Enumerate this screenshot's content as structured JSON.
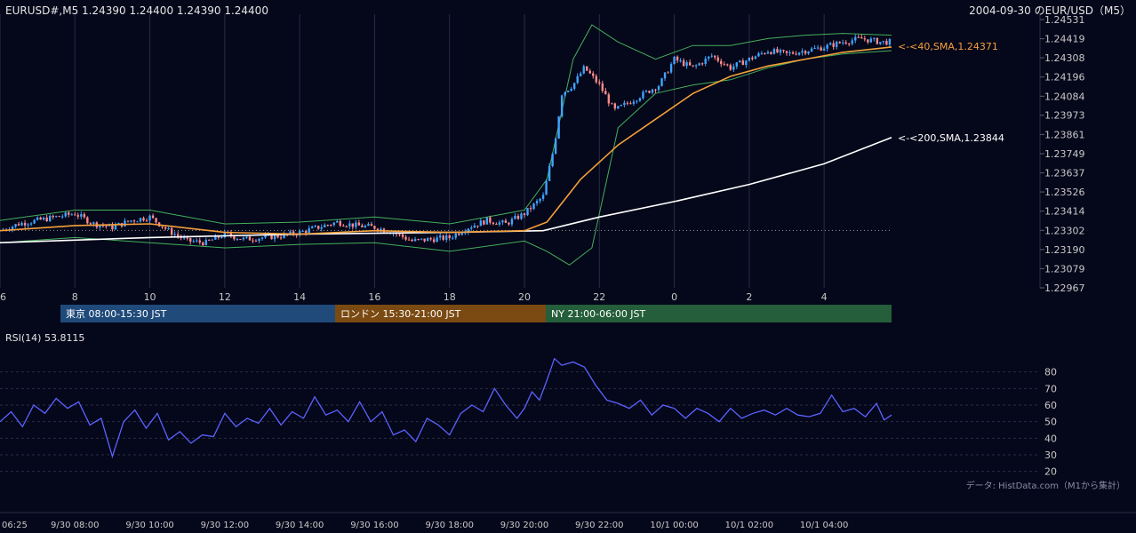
{
  "header": {
    "symbol_info": "EURUSD#,M5 1.24390 1.24400 1.24390 1.24400",
    "chart_title": "2004-09-30 のEUR/USD（M5）"
  },
  "colors": {
    "background": "#05071a",
    "grid": "#2a2d44",
    "bull": "#3fa4ff",
    "bear": "#ff8a8a",
    "sma40": "#f4a03a",
    "sma200": "#ffffff",
    "bollinger": "#43b05c",
    "rsi": "#5a62ff",
    "tokyo": "#1f4a7a",
    "london": "#7a4a12",
    "newyork": "#245e3a"
  },
  "sessions": [
    {
      "label": "東京 08:00-15:30 JST",
      "color": "#1f4a7a"
    },
    {
      "label": "ロンドン 15:30-21:00 JST",
      "color": "#7a4a12"
    },
    {
      "label": "NY 21:00-06:00 JST",
      "color": "#245e3a"
    }
  ],
  "sma_labels": {
    "sma40": "<-<40,SMA,1.24371",
    "sma200": "<-<200,SMA,1.23844"
  },
  "rsi_label": "RSI(14) 53.8115",
  "source_note": "データ: HistData.com（M1から集計）",
  "chart_data": [
    {
      "type": "candlestick",
      "title": "2004-09-30 のEUR/USD（M5）",
      "ylim": [
        1.22967,
        1.24531
      ],
      "y_ticks": [
        "1.24531",
        "1.24419",
        "1.24308",
        "1.24196",
        "1.24084",
        "1.23973",
        "1.23861",
        "1.23749",
        "1.23637",
        "1.23526",
        "1.23414",
        "1.23302",
        "1.23190",
        "1.23079",
        "1.22967"
      ],
      "x_ticks": [
        "6",
        "8",
        "10",
        "12",
        "14",
        "16",
        "18",
        "20",
        "22",
        "0",
        "2",
        "4"
      ],
      "x_range_hours": [
        6,
        29.8
      ],
      "reference_line": 1.23302,
      "close_path": [
        [
          6.0,
          1.233
        ],
        [
          6.5,
          1.2334
        ],
        [
          7.0,
          1.2336
        ],
        [
          7.5,
          1.2338
        ],
        [
          8.0,
          1.234
        ],
        [
          8.5,
          1.2334
        ],
        [
          9.0,
          1.2332
        ],
        [
          9.5,
          1.2336
        ],
        [
          10.0,
          1.2338
        ],
        [
          10.5,
          1.233
        ],
        [
          11.0,
          1.2324
        ],
        [
          11.5,
          1.2323
        ],
        [
          12.0,
          1.2328
        ],
        [
          12.5,
          1.2325
        ],
        [
          13.0,
          1.2326
        ],
        [
          13.5,
          1.2327
        ],
        [
          14.0,
          1.2329
        ],
        [
          14.5,
          1.2332
        ],
        [
          15.0,
          1.2335
        ],
        [
          15.5,
          1.2333
        ],
        [
          16.0,
          1.2332
        ],
        [
          16.5,
          1.2329
        ],
        [
          17.0,
          1.2324
        ],
        [
          17.5,
          1.2325
        ],
        [
          18.0,
          1.2326
        ],
        [
          18.5,
          1.2332
        ],
        [
          19.0,
          1.2336
        ],
        [
          19.5,
          1.2334
        ],
        [
          20.0,
          1.234
        ],
        [
          20.5,
          1.235
        ],
        [
          20.8,
          1.238
        ],
        [
          21.0,
          1.241
        ],
        [
          21.3,
          1.2415
        ],
        [
          21.6,
          1.2425
        ],
        [
          22.0,
          1.2415
        ],
        [
          22.4,
          1.24
        ],
        [
          22.8,
          1.2405
        ],
        [
          23.2,
          1.241
        ],
        [
          23.6,
          1.2415
        ],
        [
          24.0,
          1.243
        ],
        [
          24.5,
          1.2425
        ],
        [
          25.0,
          1.2432
        ],
        [
          25.5,
          1.2425
        ],
        [
          26.0,
          1.243
        ],
        [
          26.5,
          1.2435
        ],
        [
          27.0,
          1.2433
        ],
        [
          27.5,
          1.2435
        ],
        [
          28.0,
          1.2437
        ],
        [
          28.5,
          1.244
        ],
        [
          29.0,
          1.2442
        ],
        [
          29.5,
          1.244
        ],
        [
          29.8,
          1.244
        ]
      ],
      "sma40": [
        [
          6.0,
          1.233
        ],
        [
          8.0,
          1.2333
        ],
        [
          10.0,
          1.2334
        ],
        [
          12.0,
          1.2329
        ],
        [
          14.0,
          1.2328
        ],
        [
          16.0,
          1.233
        ],
        [
          18.0,
          1.2329
        ],
        [
          20.0,
          1.233
        ],
        [
          20.6,
          1.2335
        ],
        [
          21.5,
          1.236
        ],
        [
          22.5,
          1.238
        ],
        [
          23.5,
          1.2395
        ],
        [
          24.5,
          1.241
        ],
        [
          25.5,
          1.242
        ],
        [
          26.5,
          1.2426
        ],
        [
          27.5,
          1.243
        ],
        [
          28.5,
          1.2434
        ],
        [
          29.8,
          1.24371
        ]
      ],
      "sma200": [
        [
          6.0,
          1.2323
        ],
        [
          10.0,
          1.2326
        ],
        [
          14.0,
          1.2328
        ],
        [
          18.0,
          1.2329
        ],
        [
          20.5,
          1.233
        ],
        [
          22.0,
          1.2338
        ],
        [
          24.0,
          1.2347
        ],
        [
          26.0,
          1.2357
        ],
        [
          28.0,
          1.2369
        ],
        [
          29.8,
          1.23844
        ]
      ],
      "bollinger_upper": [
        [
          6.0,
          1.2336
        ],
        [
          8.0,
          1.2342
        ],
        [
          10.0,
          1.2342
        ],
        [
          12.0,
          1.2334
        ],
        [
          14.0,
          1.2335
        ],
        [
          16.0,
          1.2338
        ],
        [
          18.0,
          1.2334
        ],
        [
          20.0,
          1.2342
        ],
        [
          20.6,
          1.236
        ],
        [
          21.3,
          1.243
        ],
        [
          21.8,
          1.245
        ],
        [
          22.5,
          1.244
        ],
        [
          23.5,
          1.243
        ],
        [
          24.5,
          1.2438
        ],
        [
          25.5,
          1.2438
        ],
        [
          26.5,
          1.2442
        ],
        [
          27.5,
          1.2444
        ],
        [
          28.5,
          1.2445
        ],
        [
          29.8,
          1.2444
        ]
      ],
      "bollinger_lower": [
        [
          6.0,
          1.2323
        ],
        [
          8.0,
          1.2326
        ],
        [
          10.0,
          1.2323
        ],
        [
          12.0,
          1.232
        ],
        [
          14.0,
          1.2322
        ],
        [
          16.0,
          1.2323
        ],
        [
          18.0,
          1.2318
        ],
        [
          20.0,
          1.2324
        ],
        [
          20.6,
          1.2318
        ],
        [
          21.2,
          1.231
        ],
        [
          21.8,
          1.232
        ],
        [
          22.5,
          1.239
        ],
        [
          23.5,
          1.241
        ],
        [
          24.5,
          1.2415
        ],
        [
          25.5,
          1.2418
        ],
        [
          26.5,
          1.2425
        ],
        [
          27.5,
          1.243
        ],
        [
          28.5,
          1.2433
        ],
        [
          29.8,
          1.2435
        ]
      ]
    },
    {
      "type": "line",
      "title": "RSI(14) 53.8115",
      "ylim": [
        15,
        90
      ],
      "y_ticks": [
        "80",
        "70",
        "60",
        "50",
        "40",
        "30",
        "20"
      ],
      "x_ticks": [
        "06:25",
        "9/30 08:00",
        "9/30 10:00",
        "9/30 12:00",
        "9/30 14:00",
        "9/30 16:00",
        "9/30 18:00",
        "9/30 20:00",
        "9/30 22:00",
        "10/1 00:00",
        "10/1 02:00",
        "10/1 04:00"
      ],
      "rsi_path": [
        [
          6.0,
          50
        ],
        [
          6.3,
          56
        ],
        [
          6.6,
          47
        ],
        [
          6.9,
          60
        ],
        [
          7.2,
          55
        ],
        [
          7.5,
          64
        ],
        [
          7.8,
          58
        ],
        [
          8.1,
          62
        ],
        [
          8.4,
          48
        ],
        [
          8.7,
          52
        ],
        [
          9.0,
          29
        ],
        [
          9.3,
          50
        ],
        [
          9.6,
          57
        ],
        [
          9.9,
          46
        ],
        [
          10.2,
          55
        ],
        [
          10.5,
          39
        ],
        [
          10.8,
          44
        ],
        [
          11.1,
          37
        ],
        [
          11.4,
          42
        ],
        [
          11.7,
          41
        ],
        [
          12.0,
          55
        ],
        [
          12.3,
          47
        ],
        [
          12.6,
          52
        ],
        [
          12.9,
          49
        ],
        [
          13.2,
          58
        ],
        [
          13.5,
          48
        ],
        [
          13.8,
          56
        ],
        [
          14.1,
          52
        ],
        [
          14.4,
          65
        ],
        [
          14.7,
          54
        ],
        [
          15.0,
          57
        ],
        [
          15.3,
          50
        ],
        [
          15.6,
          62
        ],
        [
          15.9,
          50
        ],
        [
          16.2,
          56
        ],
        [
          16.5,
          42
        ],
        [
          16.8,
          45
        ],
        [
          17.1,
          38
        ],
        [
          17.4,
          52
        ],
        [
          17.7,
          48
        ],
        [
          18.0,
          42
        ],
        [
          18.3,
          55
        ],
        [
          18.6,
          60
        ],
        [
          18.9,
          56
        ],
        [
          19.2,
          70
        ],
        [
          19.5,
          60
        ],
        [
          19.8,
          52
        ],
        [
          20.0,
          58
        ],
        [
          20.2,
          68
        ],
        [
          20.4,
          63
        ],
        [
          20.6,
          75
        ],
        [
          20.8,
          88
        ],
        [
          21.0,
          84
        ],
        [
          21.3,
          86
        ],
        [
          21.6,
          83
        ],
        [
          21.9,
          72
        ],
        [
          22.2,
          63
        ],
        [
          22.5,
          61
        ],
        [
          22.8,
          58
        ],
        [
          23.1,
          63
        ],
        [
          23.4,
          54
        ],
        [
          23.7,
          60
        ],
        [
          24.0,
          58
        ],
        [
          24.3,
          52
        ],
        [
          24.6,
          58
        ],
        [
          24.9,
          55
        ],
        [
          25.2,
          50
        ],
        [
          25.5,
          58
        ],
        [
          25.8,
          52
        ],
        [
          26.1,
          55
        ],
        [
          26.4,
          57
        ],
        [
          26.7,
          54
        ],
        [
          27.0,
          58
        ],
        [
          27.3,
          54
        ],
        [
          27.6,
          53
        ],
        [
          27.9,
          55
        ],
        [
          28.2,
          66
        ],
        [
          28.5,
          56
        ],
        [
          28.8,
          58
        ],
        [
          29.1,
          53
        ],
        [
          29.4,
          61
        ],
        [
          29.6,
          51
        ],
        [
          29.8,
          54
        ]
      ]
    }
  ]
}
